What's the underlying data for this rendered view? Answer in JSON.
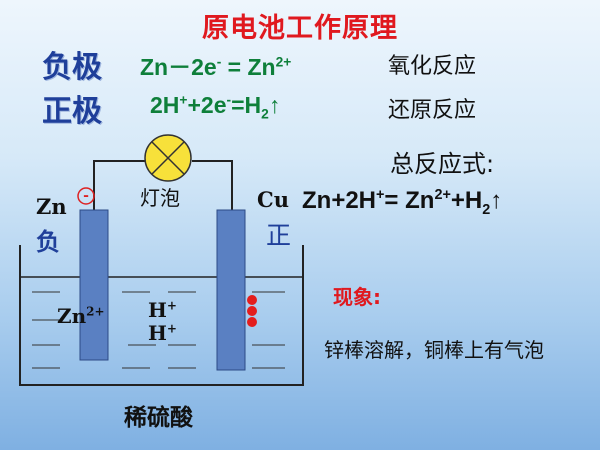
{
  "title": "原电池工作原理",
  "negative": {
    "label": "负极",
    "eq_lhs": "Zn－2e",
    "eq_lhs_sup": "-",
    "eq_rhs": " = Zn",
    "eq_rhs_sup": "2+",
    "reaction": "氧化反应"
  },
  "positive": {
    "label": "正极",
    "eq_a": "2H",
    "eq_a_sup": "+",
    "eq_b": "+2e",
    "eq_b_sup": "-",
    "eq_c": "=H",
    "eq_c_sub": "2",
    "eq_arrow": "↑",
    "reaction": "还原反应"
  },
  "overall": {
    "heading": "总反应式:",
    "eq_a": "Zn+2H",
    "eq_a_sup": "+",
    "eq_b": "= Zn",
    "eq_b_sup": "2+",
    "eq_c": "+H",
    "eq_c_sub": "2",
    "eq_arrow": "↑"
  },
  "apparatus": {
    "bulb_label": "灯泡",
    "zn_label": "Zn",
    "zn_sign": "-",
    "zn_pole": "负",
    "cu_label": "Cu",
    "cu_pole": "正",
    "ion_zn": "Zn",
    "ion_zn_sup": "2+",
    "ion_h1": "H",
    "ion_h1_sup": "+",
    "ion_h2": "H",
    "ion_h2_sup": "+",
    "solution": "稀硫酸"
  },
  "observation": {
    "heading": "现象:",
    "text": "锌棒溶解，铜棒上有气泡"
  },
  "colors": {
    "title": "#e0191f",
    "electrode_label": "#1f3f9a",
    "equation": "#0e7f3a",
    "electrode_fill": "#5a80c2",
    "bubble": "#e41d1d",
    "bulb": "#f7e13a"
  }
}
